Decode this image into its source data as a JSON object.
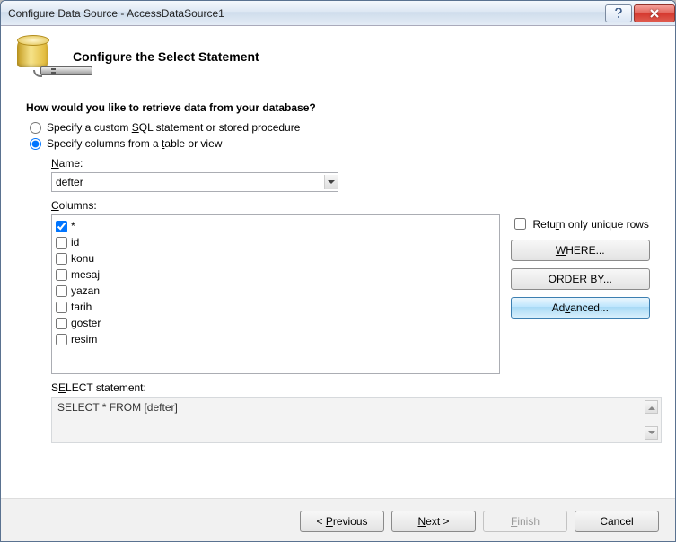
{
  "window": {
    "title": "Configure Data Source - AccessDataSource1"
  },
  "header": {
    "heading": "Configure the Select Statement"
  },
  "prompt": "How would you like to retrieve data from your database?",
  "radios": {
    "custom": {
      "label_pre": "Specify a custom ",
      "u": "S",
      "label_post": "QL statement or stored procedure"
    },
    "table": {
      "label_pre": "Specify columns from a ",
      "u": "t",
      "label_post": "able or view"
    }
  },
  "name": {
    "label_u": "N",
    "label_post": "ame:",
    "value": "defter"
  },
  "columns": {
    "label_u": "C",
    "label_post": "olumns:",
    "items": [
      {
        "label": "*",
        "checked": true
      },
      {
        "label": "id",
        "checked": false
      },
      {
        "label": "konu",
        "checked": false
      },
      {
        "label": "mesaj",
        "checked": false
      },
      {
        "label": "yazan",
        "checked": false
      },
      {
        "label": "tarih",
        "checked": false
      },
      {
        "label": "goster",
        "checked": false
      },
      {
        "label": "resim",
        "checked": false
      }
    ]
  },
  "side": {
    "unique_pre": "Retu",
    "unique_u": "r",
    "unique_post": "n only unique rows",
    "where_u": "W",
    "where_post": "HERE...",
    "order_u": "O",
    "order_post": "RDER BY...",
    "adv_pre": "Ad",
    "adv_u": "v",
    "adv_post": "anced..."
  },
  "stmt": {
    "label_pre": "S",
    "label_u": "E",
    "label_post": "LECT statement:",
    "value": "SELECT * FROM [defter]"
  },
  "footer": {
    "prev_pre": "< ",
    "prev_u": "P",
    "prev_post": "revious",
    "next_u": "N",
    "next_post": "ext >",
    "finish_u": "F",
    "finish_post": "inish",
    "cancel": "Cancel"
  }
}
